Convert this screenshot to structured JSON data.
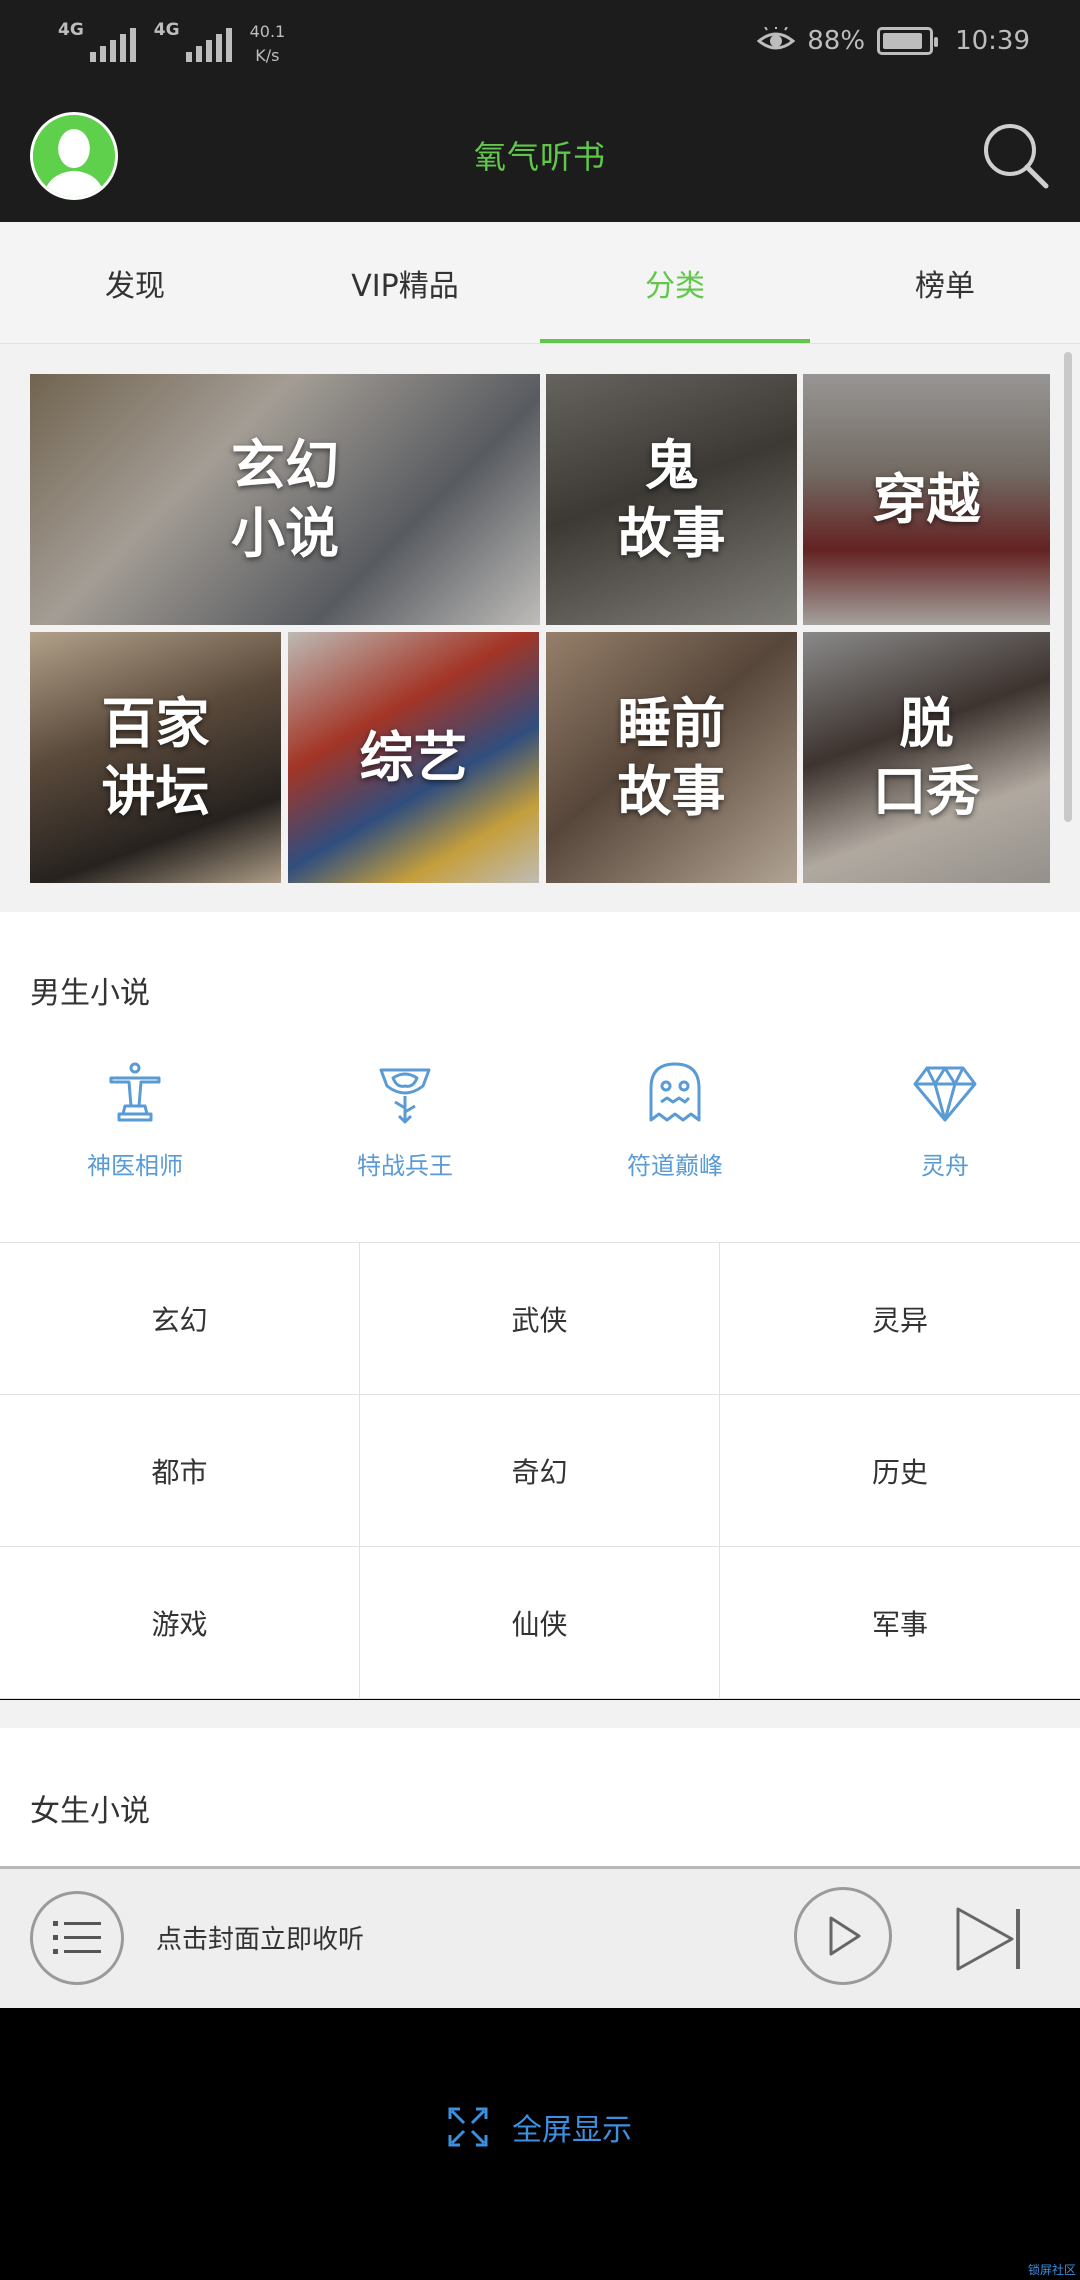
{
  "status_bar": {
    "net1": "4G",
    "net2": "4G",
    "speed_value": "40.1",
    "speed_unit": "K/s",
    "battery": "88%",
    "time": "10:39"
  },
  "header": {
    "title": "氧气听书"
  },
  "tabs": [
    {
      "label": "发现"
    },
    {
      "label": "VIP精品"
    },
    {
      "label": "分类"
    },
    {
      "label": "榜单"
    }
  ],
  "active_tab": "分类",
  "category_tiles": [
    {
      "label": "玄幻\n小说"
    },
    {
      "label": "鬼\n故事"
    },
    {
      "label": "穿越"
    },
    {
      "label": "百家\n讲坛"
    },
    {
      "label": "综艺"
    },
    {
      "label": "睡前\n故事"
    },
    {
      "label": "脱\n口秀"
    }
  ],
  "male_section": {
    "title": "男生小说",
    "featured": [
      {
        "label": "神医相师",
        "icon": "statue-icon"
      },
      {
        "label": "特战兵王",
        "icon": "rose-badge-icon"
      },
      {
        "label": "符道巅峰",
        "icon": "ghost-icon"
      },
      {
        "label": "灵舟",
        "icon": "diamond-icon"
      }
    ],
    "genres": [
      "玄幻",
      "武侠",
      "灵异",
      "都市",
      "奇幻",
      "历史",
      "游戏",
      "仙侠",
      "军事"
    ]
  },
  "female_section": {
    "title": "女生小说"
  },
  "player": {
    "hint": "点击封面立即收听"
  },
  "footer": {
    "fullscreen_label": "全屏显示",
    "corner_text": "锁屏社区"
  },
  "colors": {
    "accent": "#61c74a",
    "icon_blue": "#5a9bd5",
    "link_blue": "#3d8fe0"
  }
}
